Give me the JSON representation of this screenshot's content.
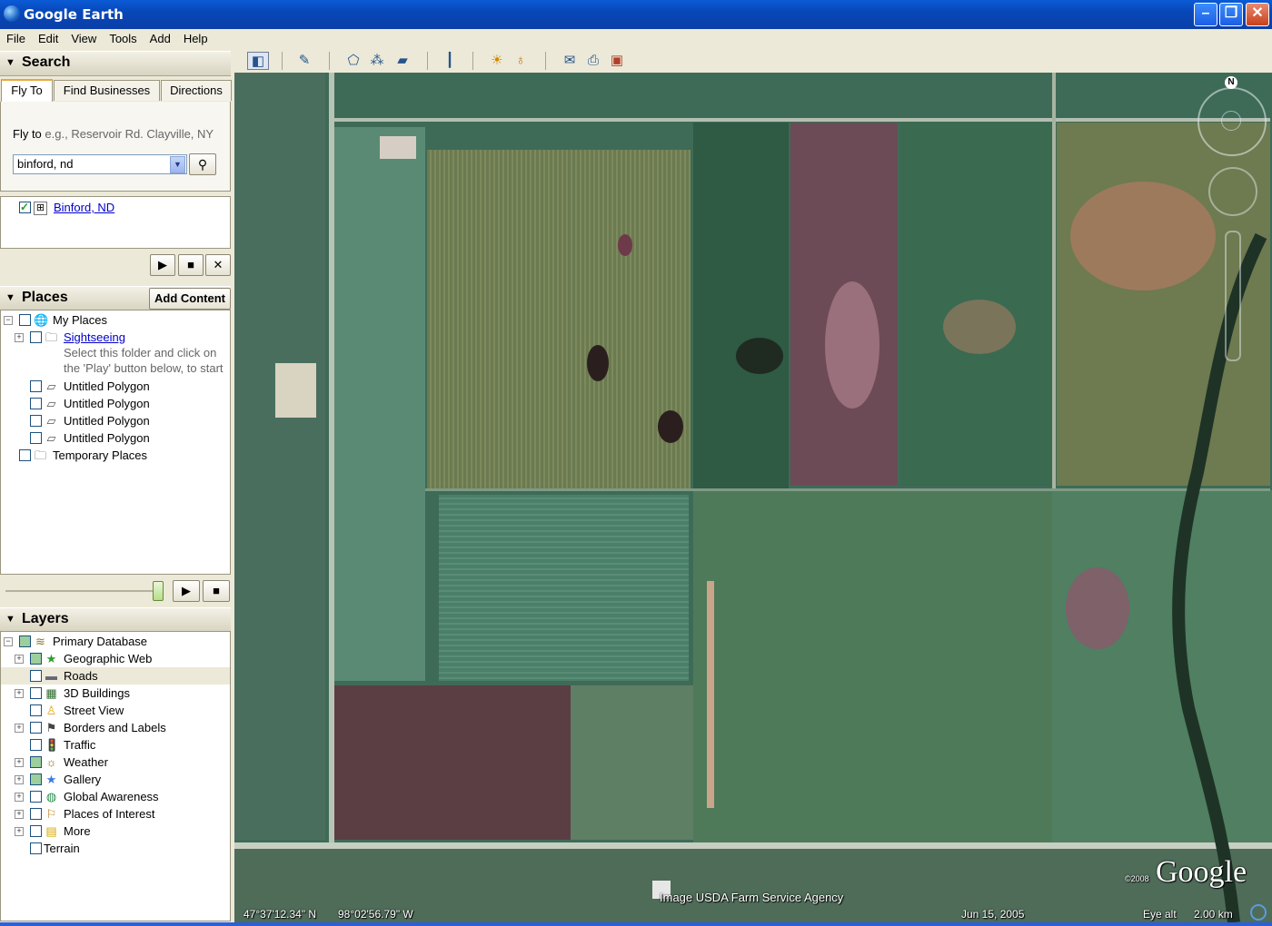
{
  "window": {
    "title": "Google Earth",
    "minimize": "–",
    "maximize": "❐",
    "close": "✕"
  },
  "menu": [
    "File",
    "Edit",
    "View",
    "Tools",
    "Add",
    "Help"
  ],
  "search": {
    "header": "Search",
    "tabs": [
      "Fly To",
      "Find Businesses",
      "Directions"
    ],
    "fly_label": "Fly to",
    "fly_hint": "e.g., Reservoir Rd. Clayville, NY",
    "input_value": "binford, nd",
    "result": "Binford, ND",
    "play": "▶",
    "stop": "■",
    "clear": "✕"
  },
  "places": {
    "header": "Places",
    "add_content": "Add Content",
    "items": [
      {
        "label": "My Places"
      },
      {
        "label": "Sightseeing",
        "desc1": "Select this folder and click on",
        "desc2": "the 'Play' button below, to start"
      },
      {
        "label": "Untitled Polygon"
      },
      {
        "label": "Untitled Polygon"
      },
      {
        "label": "Untitled Polygon"
      },
      {
        "label": "Untitled Polygon"
      },
      {
        "label": "Temporary Places"
      }
    ],
    "play": "▶",
    "stop": "■"
  },
  "layers": {
    "header": "Layers",
    "items": [
      {
        "label": "Primary Database"
      },
      {
        "label": "Geographic Web"
      },
      {
        "label": "Roads"
      },
      {
        "label": "3D Buildings"
      },
      {
        "label": "Street View"
      },
      {
        "label": "Borders and Labels"
      },
      {
        "label": "Traffic"
      },
      {
        "label": "Weather"
      },
      {
        "label": "Gallery"
      },
      {
        "label": "Global Awareness"
      },
      {
        "label": "Places of Interest"
      },
      {
        "label": "More"
      },
      {
        "label": "Terrain"
      }
    ]
  },
  "map": {
    "compass": "N",
    "attribution": "Image USDA Farm Service Agency",
    "lat": "47°37'12.34\" N",
    "lon": "98°02'56.79\" W",
    "date": "Jun 15, 2005",
    "eye_alt_label": "Eye alt",
    "eye_alt_value": "2.00 km",
    "logo": "Google",
    "logo_year": "©2008"
  }
}
